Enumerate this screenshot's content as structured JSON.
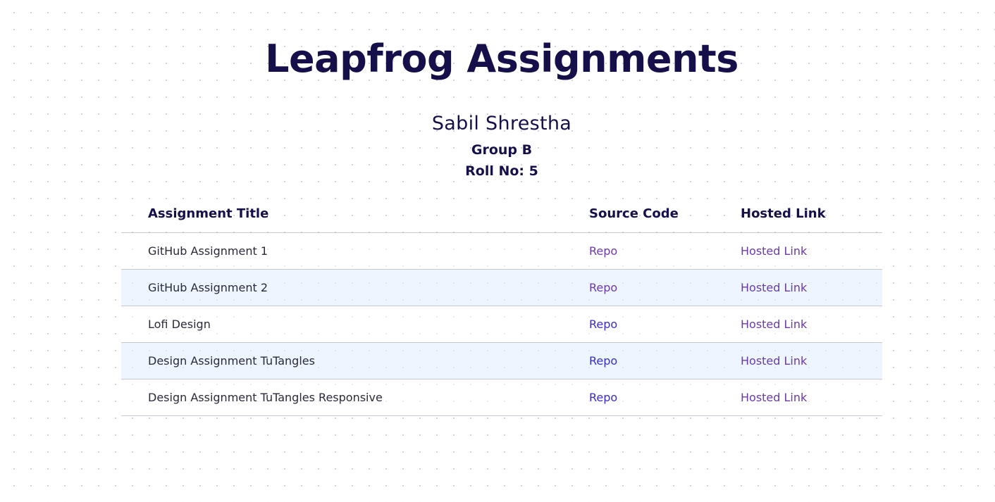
{
  "page": {
    "title": "Leapfrog Assignments"
  },
  "student": {
    "name": "Sabil Shrestha",
    "group": "Group B",
    "roll": "Roll No: 5"
  },
  "table": {
    "headers": {
      "title": "Assignment Title",
      "source": "Source Code",
      "hosted": "Hosted Link"
    },
    "rows": [
      {
        "title": "GitHub Assignment 1",
        "repo": "Repo",
        "hosted": "Hosted Link",
        "repo_visited": true
      },
      {
        "title": "GitHub Assignment 2",
        "repo": "Repo",
        "hosted": "Hosted Link",
        "repo_visited": true
      },
      {
        "title": "Lofi Design",
        "repo": "Repo",
        "hosted": "Hosted Link",
        "repo_visited": false
      },
      {
        "title": "Design Assignment TuTangles",
        "repo": "Repo",
        "hosted": "Hosted Link",
        "repo_visited": false
      },
      {
        "title": "Design Assignment TuTangles Responsive",
        "repo": "Repo",
        "hosted": "Hosted Link",
        "repo_visited": false
      }
    ]
  },
  "colors": {
    "heading": "#15104a",
    "link_unvisited": "#3a2dc8",
    "link_visited": "#6a3aa8",
    "row_alt_bg": "#e3effd"
  }
}
